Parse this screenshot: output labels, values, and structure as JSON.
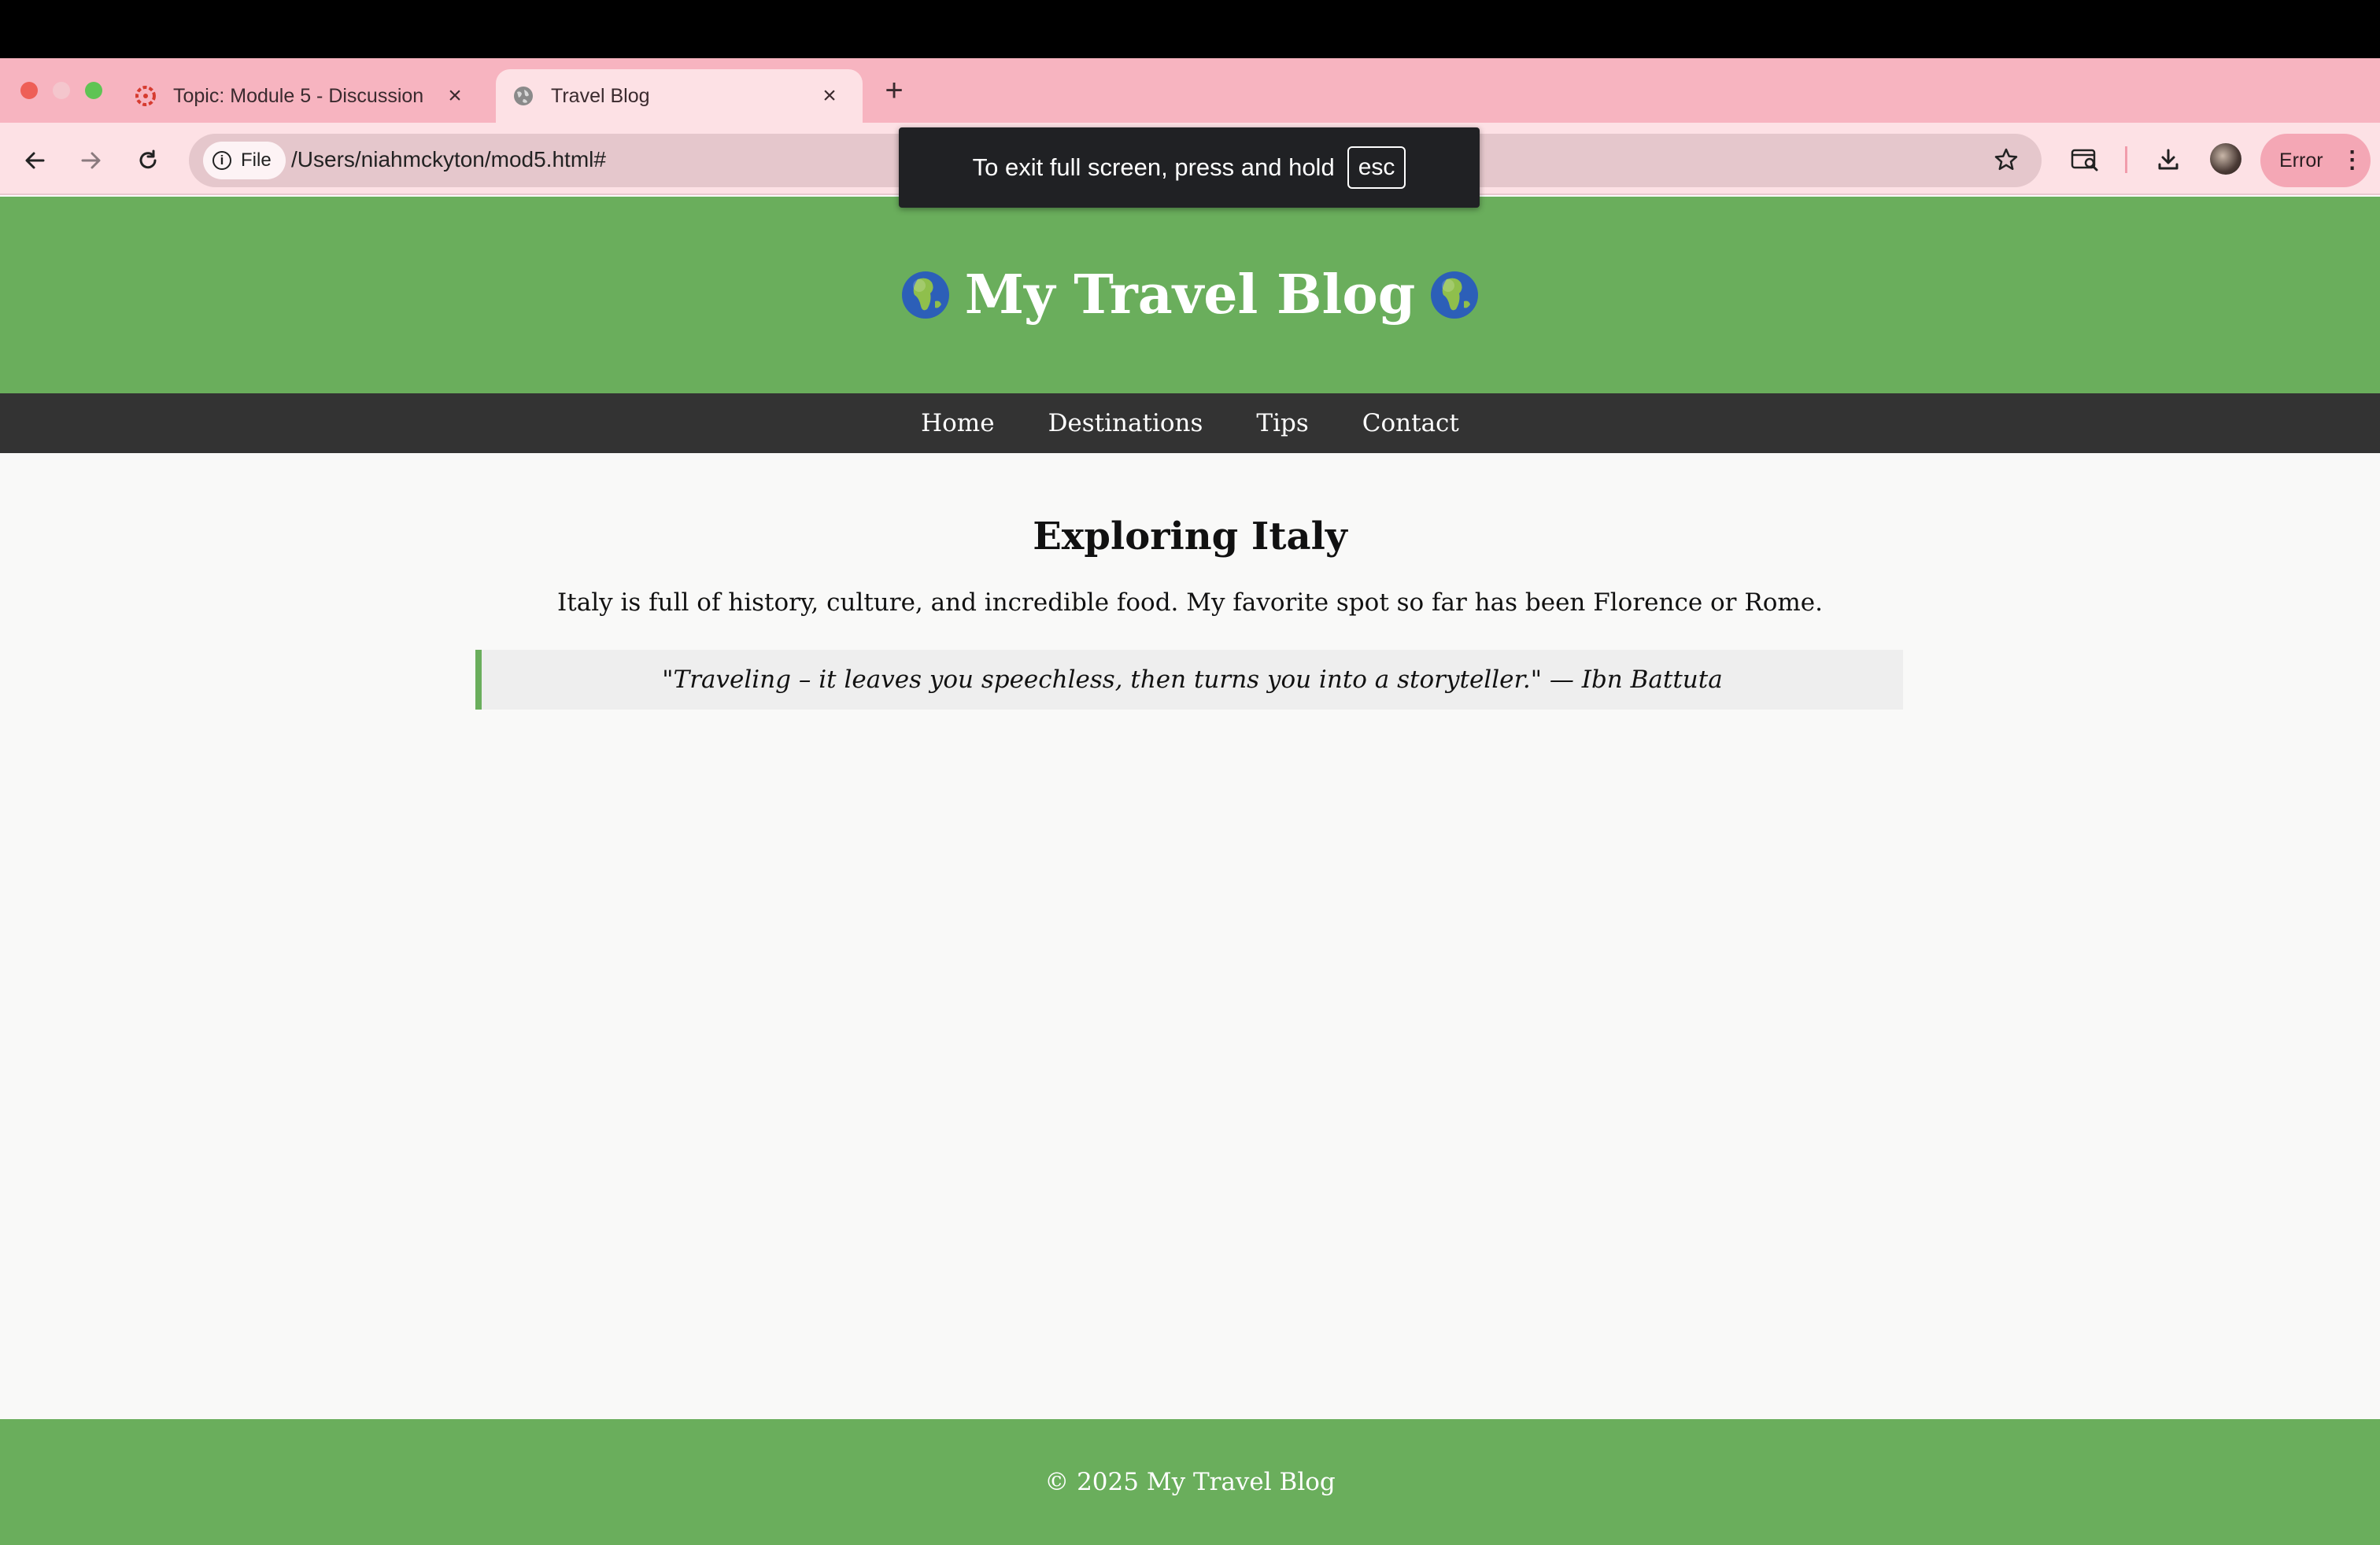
{
  "browser": {
    "tabs": [
      {
        "title": "Topic: Module 5 - Discussion",
        "icon": "canvas-logo-icon"
      },
      {
        "title": "Travel Blog",
        "icon": "globe-favicon-icon"
      }
    ],
    "new_tab": "+",
    "chip_label": "File",
    "url": "/Users/niahmckyton/mod5.html#",
    "error_label": "Error",
    "fullscreen_message": "To exit full screen, press and hold",
    "fullscreen_key": "esc",
    "colors": {
      "tabstrip": "#f7b4c0",
      "toolbar": "#fde1e5",
      "error_button": "#f4a7b5"
    }
  },
  "site": {
    "title": "My Travel Blog",
    "title_emoji": "globe-earth-africa-icon",
    "nav": [
      "Home",
      "Destinations",
      "Tips",
      "Contact"
    ],
    "heading": "Exploring Italy",
    "paragraph": "Italy is full of history, culture, and incredible food. My favorite spot so far has been Florence or Rome.",
    "quote": "\"Traveling – it leaves you speechless, then turns you into a storyteller.\" — Ibn Battuta",
    "footer": "© 2025 My Travel Blog",
    "colors": {
      "header": "#6aae5c",
      "nav": "#333333",
      "background": "#f9f9f8"
    }
  }
}
